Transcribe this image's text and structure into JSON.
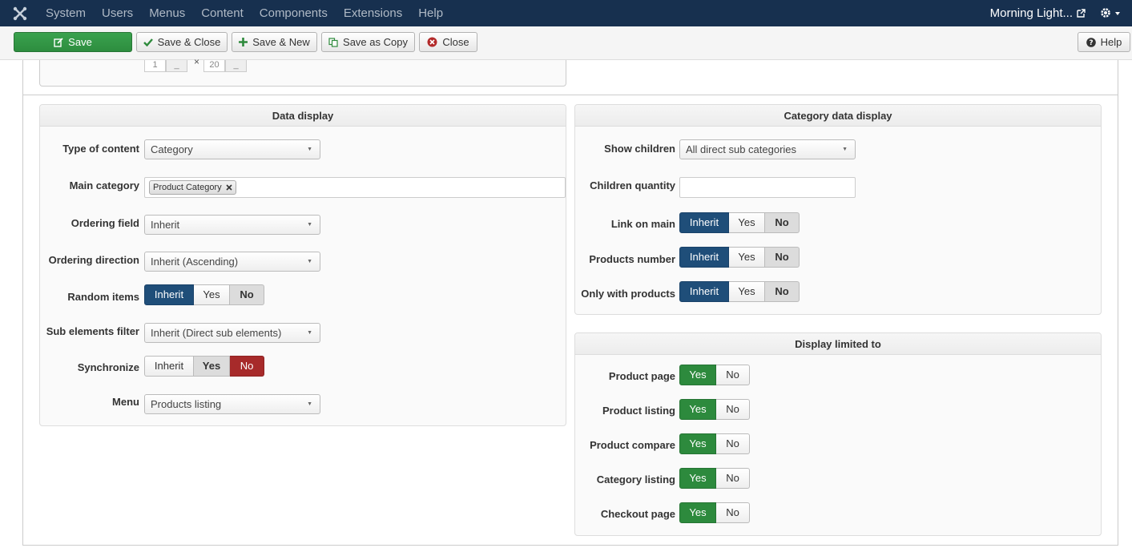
{
  "navbar": {
    "menu": [
      "System",
      "Users",
      "Menus",
      "Content",
      "Components",
      "Extensions",
      "Help"
    ],
    "site_name": "Morning Light..."
  },
  "toolbar": {
    "save": "Save",
    "save_close": "Save & Close",
    "save_new": "Save & New",
    "save_copy": "Save as Copy",
    "close": "Close",
    "help": "Help"
  },
  "top_fieldset": {
    "value_a": "1",
    "value_b": "20",
    "times": "×",
    "dash": "_"
  },
  "data_display": {
    "title": "Data display",
    "type_of_content": {
      "label": "Type of content",
      "value": "Category"
    },
    "main_category": {
      "label": "Main category",
      "tag": "Product Category"
    },
    "ordering_field": {
      "label": "Ordering field",
      "value": "Inherit"
    },
    "ordering_direction": {
      "label": "Ordering direction",
      "value": "Inherit (Ascending)"
    },
    "random_items": {
      "label": "Random items",
      "options": [
        "Inherit",
        "Yes",
        "No"
      ]
    },
    "sub_elements_filter": {
      "label": "Sub elements filter",
      "value": "Inherit (Direct sub elements)"
    },
    "synchronize": {
      "label": "Synchronize",
      "options": [
        "Inherit",
        "Yes",
        "No"
      ]
    },
    "menu": {
      "label": "Menu",
      "value": "Products listing"
    }
  },
  "category_data_display": {
    "title": "Category data display",
    "show_children": {
      "label": "Show children",
      "value": "All direct sub categories"
    },
    "children_quantity": {
      "label": "Children quantity",
      "value": ""
    },
    "link_on_main": {
      "label": "Link on main",
      "options": [
        "Inherit",
        "Yes",
        "No"
      ]
    },
    "products_number": {
      "label": "Products number",
      "options": [
        "Inherit",
        "Yes",
        "No"
      ]
    },
    "only_with_products": {
      "label": "Only with products",
      "options": [
        "Inherit",
        "Yes",
        "No"
      ]
    }
  },
  "display_limited_to": {
    "title": "Display limited to",
    "product_page": {
      "label": "Product page",
      "options": [
        "Yes",
        "No"
      ]
    },
    "product_listing": {
      "label": "Product listing",
      "options": [
        "Yes",
        "No"
      ]
    },
    "product_compare": {
      "label": "Product compare",
      "options": [
        "Yes",
        "No"
      ]
    },
    "category_listing": {
      "label": "Category listing",
      "options": [
        "Yes",
        "No"
      ]
    },
    "checkout_page": {
      "label": "Checkout page",
      "options": [
        "Yes",
        "No"
      ]
    }
  },
  "colors": {
    "navbar": "#17304f",
    "save_green": "#2d8d3f",
    "inherit_blue": "#1f4e79",
    "no_red": "#a72a2a",
    "yes_green": "#2d8a3d"
  }
}
